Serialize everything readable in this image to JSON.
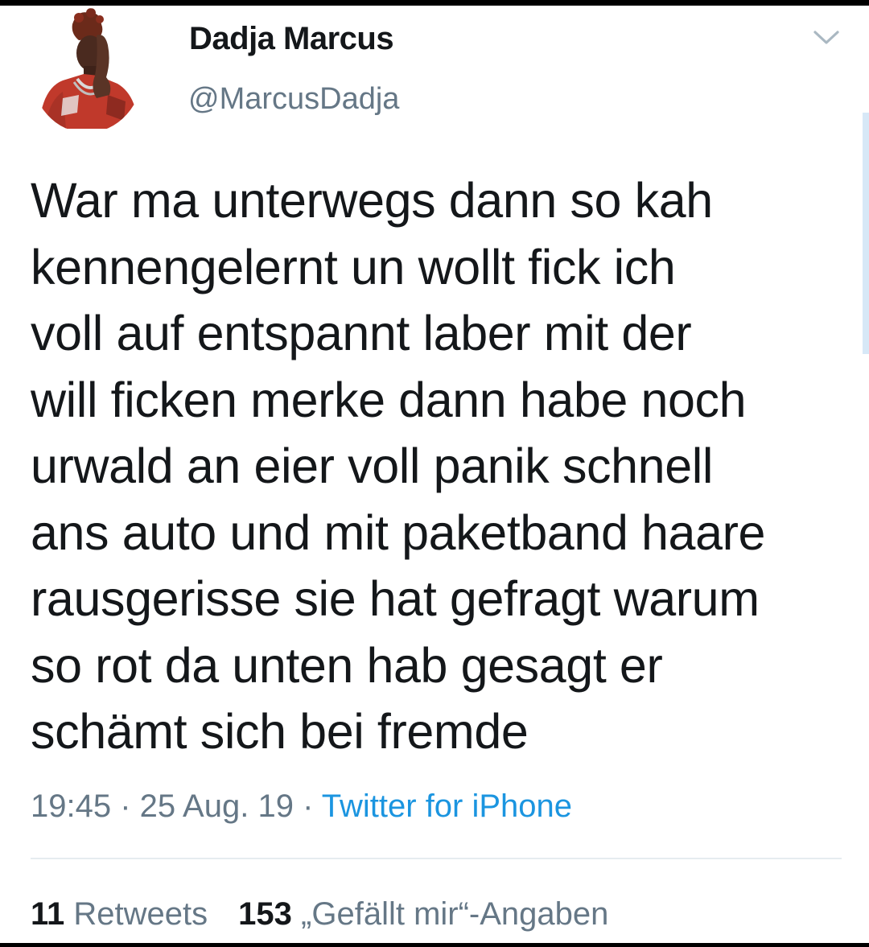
{
  "tweet": {
    "author": {
      "display_name": "Dadja Marcus",
      "handle": "@MarcusDadja"
    },
    "text": "War ma unterwegs dann so kah\nkennengelernt un wollt fick ich\nvoll auf entspannt laber mit der\nwill ficken merke dann habe noch\nurwald an eier voll panik schnell\nans auto und mit paketband haare\nrausgerisse sie hat gefragt warum\nso rot da unten hab gesagt er\nschämt sich bei fremde",
    "time": "19:45",
    "date": "25 Aug. 19",
    "separator": " · ",
    "source": "Twitter for iPhone",
    "stats": {
      "retweets_count": "11",
      "retweets_label": "Retweets",
      "likes_count": "153",
      "likes_label": "„Gefällt mir“-Angaben"
    }
  },
  "icons": {
    "menu": "chevron-down-icon",
    "avatar": "profile-photo"
  },
  "colors": {
    "text_primary": "#14171a",
    "text_secondary": "#657786",
    "link": "#1b95e0",
    "divider": "#e6ecf0"
  }
}
